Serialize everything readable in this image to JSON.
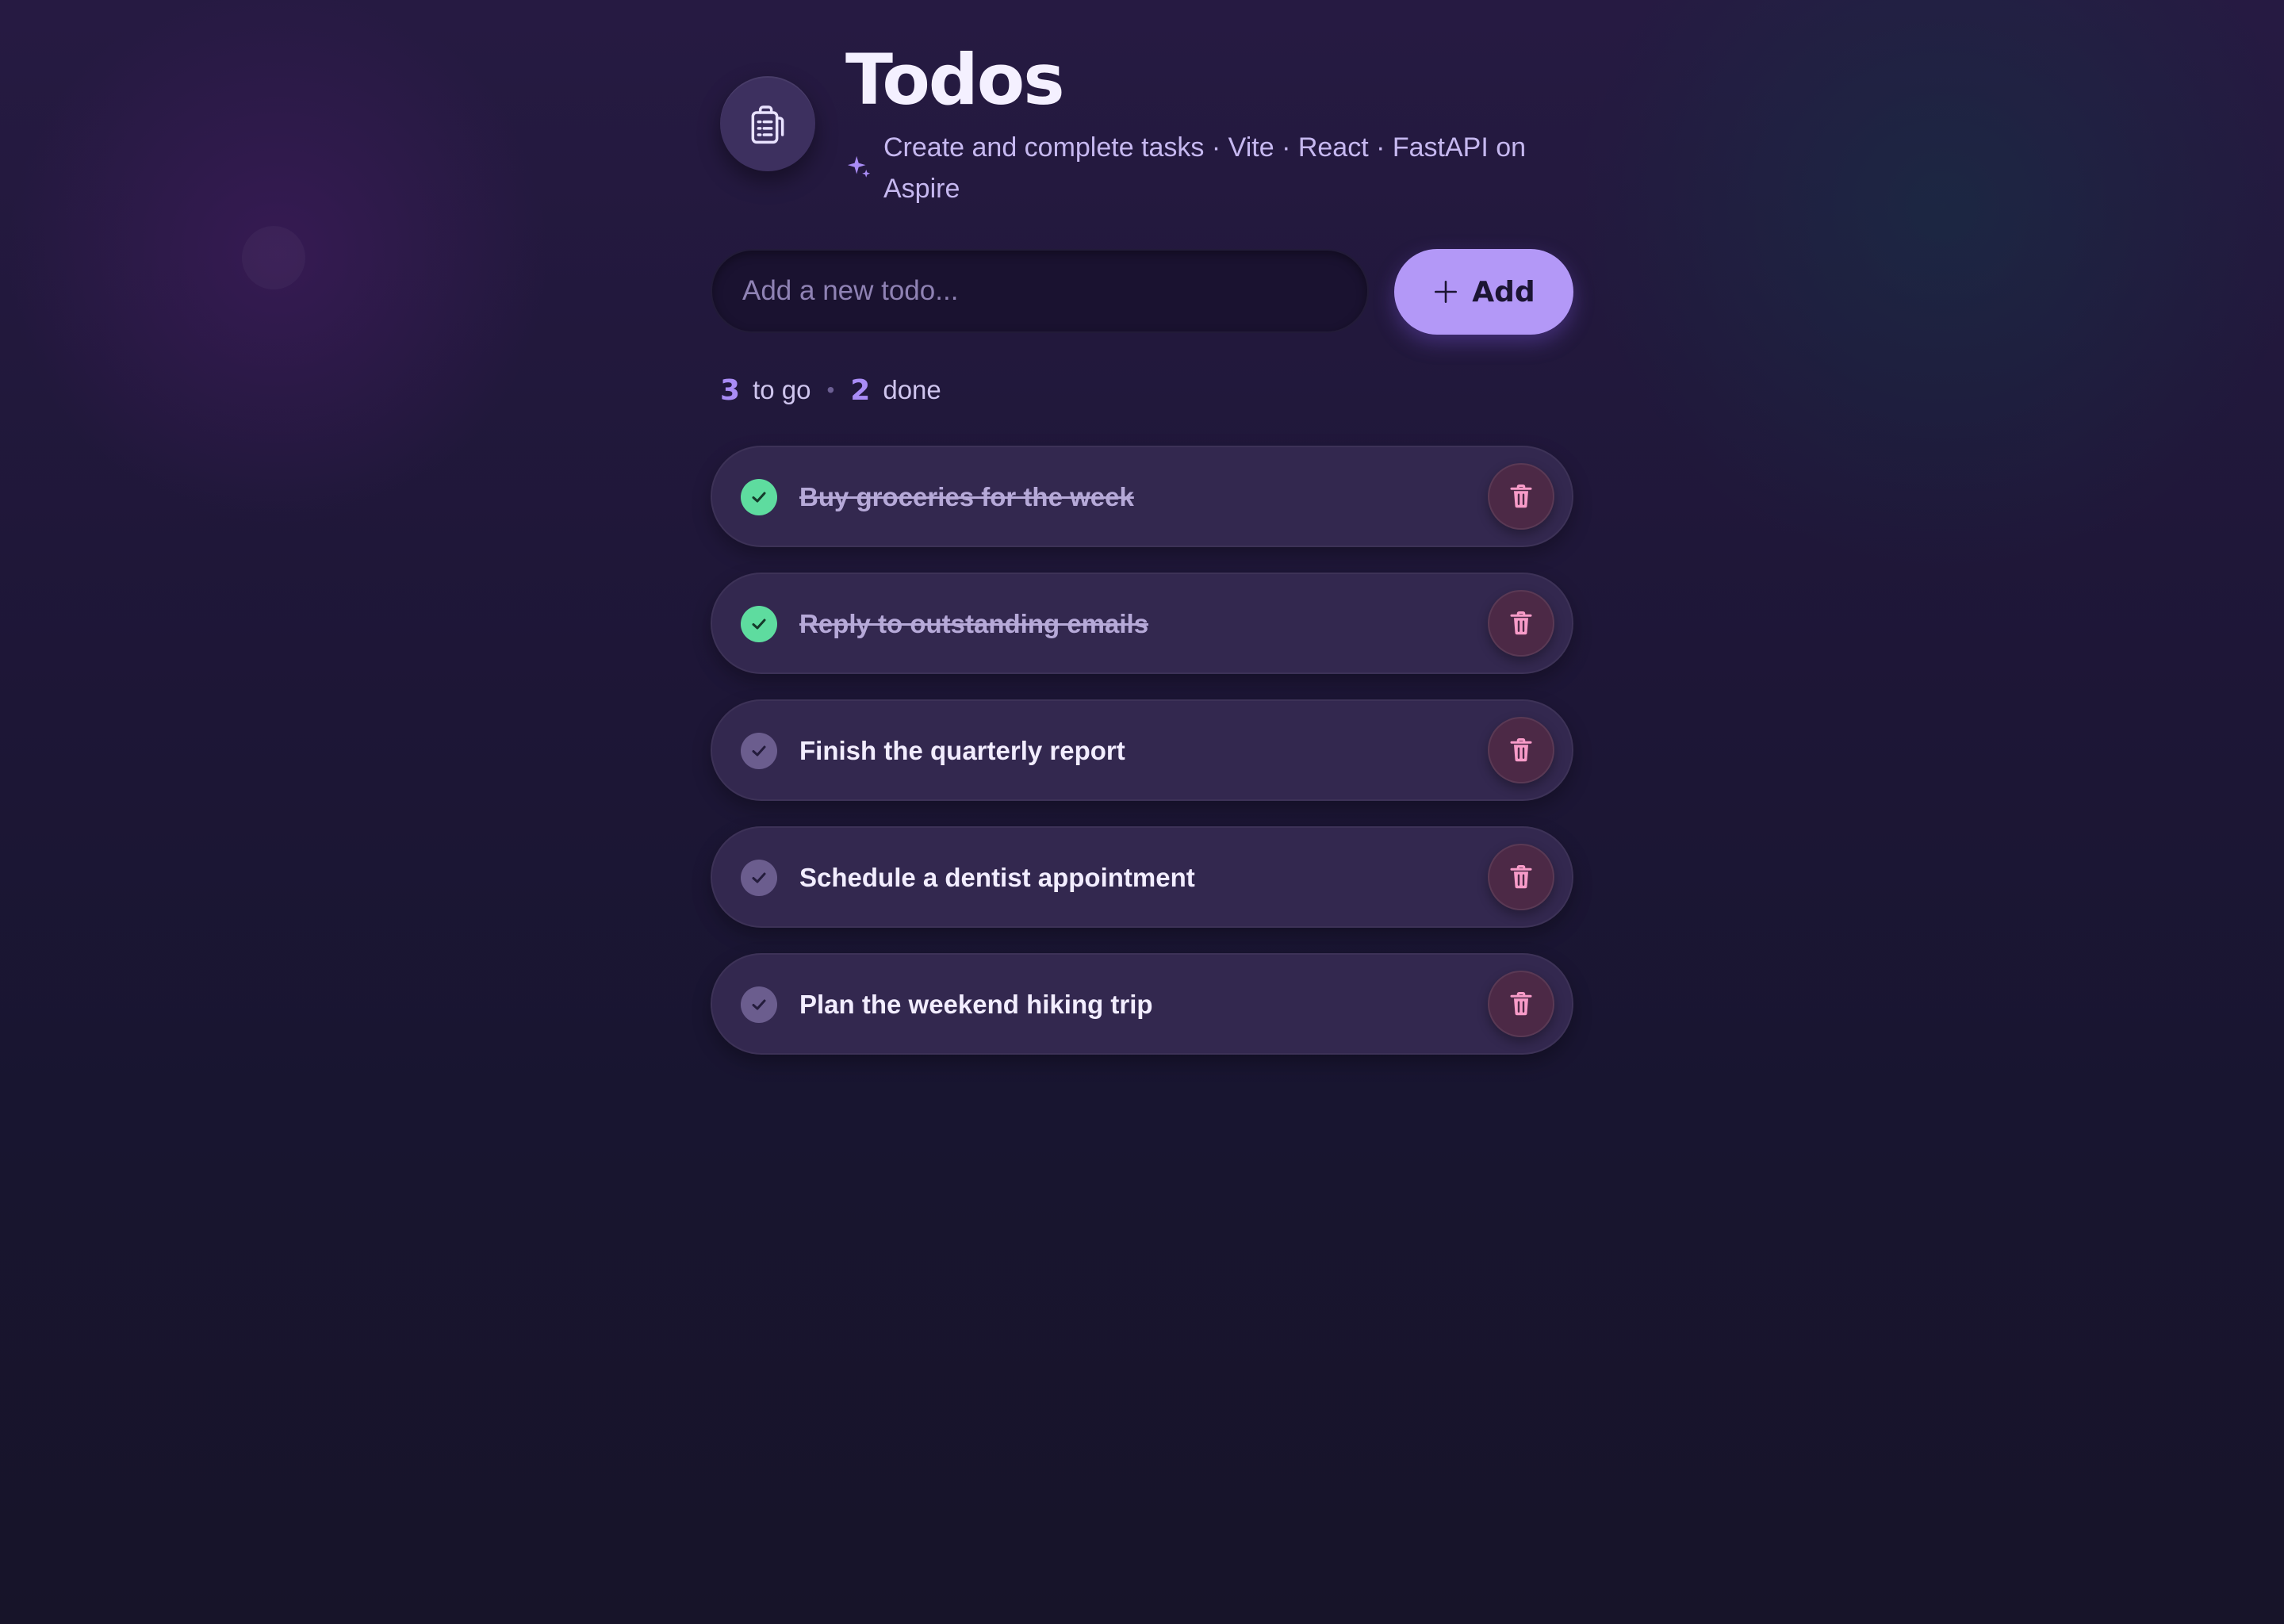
{
  "app": {
    "title": "Todos",
    "subtitle": "Create and complete tasks · Vite · React · FastAPI on Aspire",
    "logo_icon": "clipboard-list-icon",
    "subtitle_icon": "sparkle-icon"
  },
  "input": {
    "placeholder": "Add a new todo...",
    "value": ""
  },
  "add_button": {
    "label": "Add",
    "icon": "plus-icon"
  },
  "stats": {
    "remaining": "3",
    "remaining_label": "to go",
    "separator": "•",
    "done": "2",
    "done_label": "done"
  },
  "todos": [
    {
      "text": "Buy groceries for the week",
      "completed": true
    },
    {
      "text": "Reply to outstanding emails",
      "completed": true
    },
    {
      "text": "Finish the quarterly report",
      "completed": false
    },
    {
      "text": "Schedule a dentist appointment",
      "completed": false
    },
    {
      "text": "Plan the weekend hiking trip",
      "completed": false
    }
  ],
  "colors": {
    "accent": "#b398f7",
    "stat_number": "#a98cf6",
    "check_done": "#5edc9f",
    "check_pending": "#6b5d8e",
    "delete_icon": "#f79bc8",
    "card": "#33284f"
  }
}
